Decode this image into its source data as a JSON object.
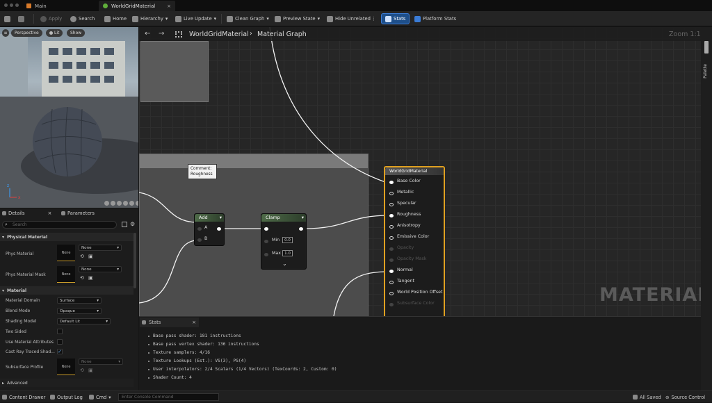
{
  "titlebar": {
    "tabs": [
      {
        "label": "Main"
      },
      {
        "label": "WorldGridMaterial"
      }
    ],
    "close_glyph": "×"
  },
  "toolbar": {
    "apply": "Apply",
    "search": "Search",
    "home": "Home",
    "hierarchy": "Hierarchy",
    "live_update": "Live Update",
    "clean_graph": "Clean Graph",
    "preview_state": "Preview State",
    "hide_unrelated": "Hide Unrelated",
    "stats": "Stats",
    "platform_stats": "Platform Stats"
  },
  "viewport": {
    "perspective": "Perspective",
    "lit": "Lit",
    "show": "Show",
    "axis_z": "z",
    "axis_x": "x"
  },
  "details": {
    "tab_details": "Details",
    "tab_parameters": "Parameters",
    "search_placeholder": "Search",
    "section_physical": "Physical Material",
    "phys_material": "Phys Material",
    "phys_material_mask": "Phys Material Mask",
    "none": "None",
    "section_material": "Material",
    "material_domain": "Material Domain",
    "material_domain_value": "Surface",
    "blend_mode": "Blend Mode",
    "blend_mode_value": "Opaque",
    "shading_model": "Shading Model",
    "shading_model_value": "Default Lit",
    "two_sided": "Two Sided",
    "use_material_attributes": "Use Material Attributes",
    "cast_ray_traced": "Cast Ray Traced Shad...",
    "subsurface_profile": "Subsurface Profile",
    "section_advanced": "Advanced"
  },
  "graph": {
    "breadcrumb_root": "WorldGridMaterial",
    "breadcrumb_child": "Material Graph",
    "zoom": "Zoom 1:1",
    "comment_title": "Comment:",
    "comment_body": "Roughness",
    "add_node": {
      "title": "Add",
      "pin_a": "A",
      "pin_b": "B"
    },
    "clamp_node": {
      "title": "Clamp",
      "min_label": "Min",
      "min_value": "0.0",
      "max_label": "Max",
      "max_value": "1.0"
    },
    "result_node": {
      "title": "WorldGridMaterial",
      "pins": [
        "Base Color",
        "Metallic",
        "Specular",
        "Roughness",
        "Anisotropy",
        "Emissive Color",
        "Opacity",
        "Opacity Mask",
        "Normal",
        "Tangent",
        "World Position Offset",
        "Subsurface Color"
      ]
    },
    "watermark": "MATERIAL"
  },
  "palette": {
    "label": "Palette"
  },
  "stats_panel": {
    "tab": "Stats",
    "lines": [
      "Base pass shader: 181 instructions",
      "Base pass vertex shader: 136 instructions",
      "Texture samplers: 4/16",
      "Texture Lookups (Est.): VS(3), PS(4)",
      "User interpolators: 2/4 Scalars (1/4 Vectors) (TexCoords: 2, Custom: 0)",
      "Shader Count: 4"
    ]
  },
  "bottombar": {
    "content_drawer": "Content Drawer",
    "output_log": "Output Log",
    "cmd": "Cmd",
    "console_placeholder": "Enter Console Command",
    "all_saved": "All Saved",
    "source_control": "Source Control"
  },
  "colors": {
    "accent_blue": "#1e4f8a",
    "result_node_border": "#e0a020",
    "node_header_green": "#4e6b48"
  }
}
